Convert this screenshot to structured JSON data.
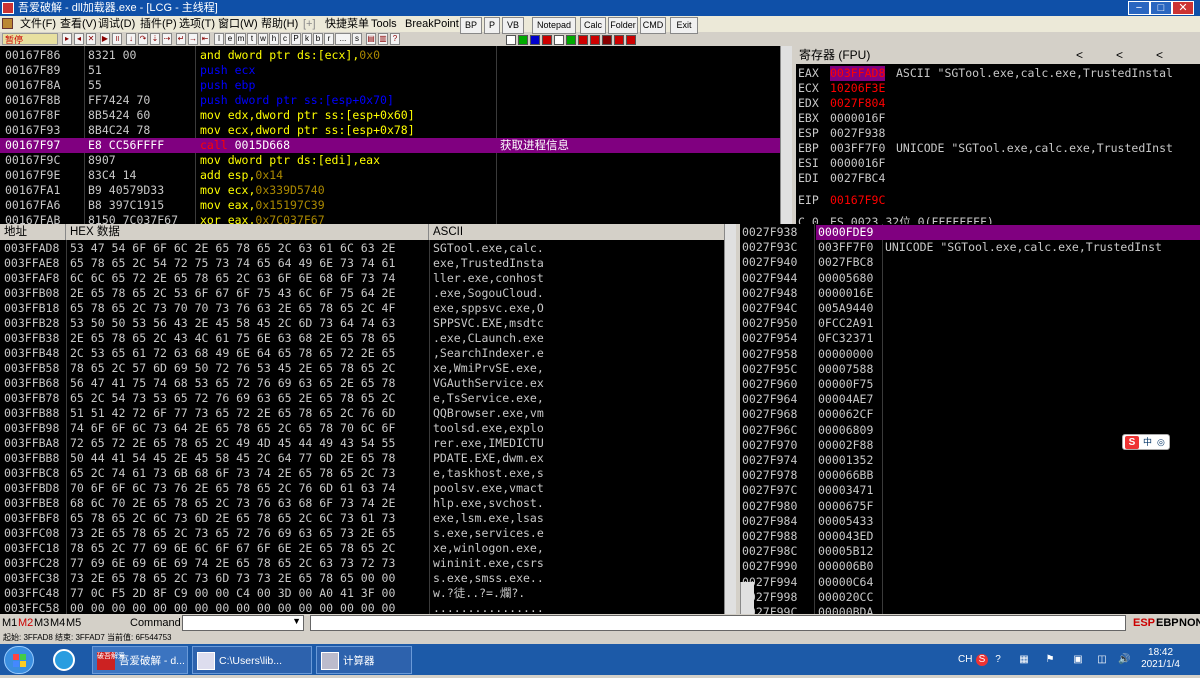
{
  "titlebar": {
    "title": "吾爱破解 - dll加载器.exe - [LCG - 主线程]"
  },
  "menu": [
    "文件(F)",
    "查看(V)",
    "调试(D)",
    "插件(P)",
    "选项(T)",
    "窗口(W)",
    "帮助(H)",
    "[+]",
    "快捷菜单",
    "Tools",
    "BreakPoint"
  ],
  "tabs": [
    "BP",
    "P",
    "VB",
    "Notepad",
    "Calc",
    "Folder",
    "CMD",
    "Exit"
  ],
  "toolbar": {
    "state": "暂停",
    "letters": [
      "l",
      "e",
      "m",
      "t",
      "w",
      "h",
      "c",
      "P",
      "k",
      "b",
      "r",
      "...",
      "s"
    ]
  },
  "disasm": [
    {
      "addr": "00167F86",
      "hex": "8321 00",
      "asm": [
        [
          "and",
          "#ff0"
        ],
        [
          " dword ptr ds:[ecx],",
          "#ff0"
        ],
        [
          "0x0",
          "#a80"
        ]
      ],
      "cmt": ""
    },
    {
      "addr": "00167F89",
      "hex": "51",
      "asm": [
        [
          "push",
          "#00f"
        ],
        [
          " ecx",
          "#00f"
        ]
      ],
      "cmt": ""
    },
    {
      "addr": "00167F8A",
      "hex": "55",
      "asm": [
        [
          "push",
          "#00f"
        ],
        [
          " ebp",
          "#00f"
        ]
      ],
      "cmt": ""
    },
    {
      "addr": "00167F8B",
      "hex": "FF7424 70",
      "asm": [
        [
          "push",
          "#00f"
        ],
        [
          " dword ptr ss:[esp+0x70]",
          "#00f"
        ]
      ],
      "cmt": ""
    },
    {
      "addr": "00167F8F",
      "hex": "8B5424 60",
      "asm": [
        [
          "mov",
          "#ff0"
        ],
        [
          " edx,dword ptr ss:[esp+0x60]",
          "#ff0"
        ]
      ],
      "cmt": ""
    },
    {
      "addr": "00167F93",
      "hex": "8B4C24 78",
      "asm": [
        [
          "mov",
          "#ff0"
        ],
        [
          " ecx,dword ptr ss:[esp+0x78]",
          "#ff0"
        ]
      ],
      "cmt": ""
    },
    {
      "addr": "00167F97",
      "hex": "E8 CC56FFFF",
      "asm": [
        [
          "call",
          "#f00"
        ],
        [
          " 0015D668",
          "#fff"
        ]
      ],
      "cmt": "获取进程信息",
      "sel": true
    },
    {
      "addr": "00167F9C",
      "hex": "8907",
      "asm": [
        [
          "mov",
          "#ff0"
        ],
        [
          " dword ptr ds:[edi],eax",
          "#ff0"
        ]
      ],
      "cmt": ""
    },
    {
      "addr": "00167F9E",
      "hex": "83C4 14",
      "asm": [
        [
          "add",
          "#ff0"
        ],
        [
          " esp,",
          "#ff0"
        ],
        [
          "0x14",
          "#a80"
        ]
      ],
      "cmt": ""
    },
    {
      "addr": "00167FA1",
      "hex": "B9 40579D33",
      "asm": [
        [
          "mov",
          "#ff0"
        ],
        [
          " ecx,",
          "#ff0"
        ],
        [
          "0x339D5740",
          "#a80"
        ]
      ],
      "cmt": ""
    },
    {
      "addr": "00167FA6",
      "hex": "B8 397C1915",
      "asm": [
        [
          "mov",
          "#ff0"
        ],
        [
          " eax,",
          "#ff0"
        ],
        [
          "0x15197C39",
          "#a80"
        ]
      ],
      "cmt": ""
    },
    {
      "addr": "00167FAB",
      "hex": "8150 7C037F67",
      "asm": [
        [
          "xor",
          "#ff0"
        ],
        [
          " eax,",
          "#ff0"
        ],
        [
          "0x7C037F67",
          "#a80"
        ]
      ],
      "cmt": ""
    }
  ],
  "registers": {
    "header": "寄存器 (FPU)",
    "arrows": [
      "<",
      "<",
      "<"
    ],
    "rows": [
      {
        "name": "EAX",
        "val": "003FFAD8",
        "valcolor": "#f00",
        "hl": true,
        "desc": "ASCII \"SGTool.exe,calc.exe,TrustedInstal"
      },
      {
        "name": "ECX",
        "val": "10206F3E",
        "valcolor": "#f00",
        "desc": ""
      },
      {
        "name": "EDX",
        "val": "0027F804",
        "valcolor": "#f00",
        "desc": ""
      },
      {
        "name": "EBX",
        "val": "0000016F",
        "valcolor": "#c8c8c8",
        "desc": ""
      },
      {
        "name": "ESP",
        "val": "0027F938",
        "valcolor": "#c8c8c8",
        "desc": ""
      },
      {
        "name": "EBP",
        "val": "003FF7F0",
        "valcolor": "#c8c8c8",
        "desc": "UNICODE \"SGTool.exe,calc.exe,TrustedInst"
      },
      {
        "name": "ESI",
        "val": "0000016F",
        "valcolor": "#c8c8c8",
        "desc": ""
      },
      {
        "name": "EDI",
        "val": "0027FBC4",
        "valcolor": "#c8c8c8",
        "desc": ""
      },
      {
        "name": "EIP",
        "val": "00167F9C",
        "valcolor": "#f00",
        "desc": ""
      },
      {
        "name": "C 0",
        "val": "ES 0023 32位 0(FFFFFFFF)",
        "valcolor": "#c8c8c8",
        "desc": ""
      }
    ]
  },
  "dump": {
    "headers": [
      "地址",
      "HEX 数据",
      "ASCII"
    ],
    "rows": [
      {
        "addr": "003FFAD8",
        "hex": "53 47 54 6F 6F 6C 2E 65 78 65 2C 63 61 6C 63 2E",
        "asc": "SGTool.exe,calc."
      },
      {
        "addr": "003FFAE8",
        "hex": "65 78 65 2C 54 72 75 73 74 65 64 49 6E 73 74 61",
        "asc": "exe,TrustedInsta"
      },
      {
        "addr": "003FFAF8",
        "hex": "6C 6C 65 72 2E 65 78 65 2C 63 6F 6E 68 6F 73 74",
        "asc": "ller.exe,conhost"
      },
      {
        "addr": "003FFB08",
        "hex": "2E 65 78 65 2C 53 6F 67 6F 75 43 6C 6F 75 64 2E",
        "asc": ".exe,SogouCloud."
      },
      {
        "addr": "003FFB18",
        "hex": "65 78 65 2C 73 70 70 73 76 63 2E 65 78 65 2C 4F",
        "asc": "exe,sppsvc.exe,O"
      },
      {
        "addr": "003FFB28",
        "hex": "53 50 50 53 56 43 2E 45 58 45 2C 6D 73 64 74 63",
        "asc": "SPPSVC.EXE,msdtc"
      },
      {
        "addr": "003FFB38",
        "hex": "2E 65 78 65 2C 43 4C 61 75 6E 63 68 2E 65 78 65",
        "asc": ".exe,CLaunch.exe"
      },
      {
        "addr": "003FFB48",
        "hex": "2C 53 65 61 72 63 68 49 6E 64 65 78 65 72 2E 65",
        "asc": ",SearchIndexer.e"
      },
      {
        "addr": "003FFB58",
        "hex": "78 65 2C 57 6D 69 50 72 76 53 45 2E 65 78 65 2C",
        "asc": "xe,WmiPrvSE.exe,"
      },
      {
        "addr": "003FFB68",
        "hex": "56 47 41 75 74 68 53 65 72 76 69 63 65 2E 65 78",
        "asc": "VGAuthService.ex"
      },
      {
        "addr": "003FFB78",
        "hex": "65 2C 54 73 53 65 72 76 69 63 65 2E 65 78 65 2C",
        "asc": "e,TsService.exe,"
      },
      {
        "addr": "003FFB88",
        "hex": "51 51 42 72 6F 77 73 65 72 2E 65 78 65 2C 76 6D",
        "asc": "QQBrowser.exe,vm"
      },
      {
        "addr": "003FFB98",
        "hex": "74 6F 6F 6C 73 64 2E 65 78 65 2C 65 78 70 6C 6F",
        "asc": "toolsd.exe,explo"
      },
      {
        "addr": "003FFBA8",
        "hex": "72 65 72 2E 65 78 65 2C 49 4D 45 44 49 43 54 55",
        "asc": "rer.exe,IMEDICTU"
      },
      {
        "addr": "003FFBB8",
        "hex": "50 44 41 54 45 2E 45 58 45 2C 64 77 6D 2E 65 78",
        "asc": "PDATE.EXE,dwm.ex"
      },
      {
        "addr": "003FFBC8",
        "hex": "65 2C 74 61 73 6B 68 6F 73 74 2E 65 78 65 2C 73",
        "asc": "e,taskhost.exe,s"
      },
      {
        "addr": "003FFBD8",
        "hex": "70 6F 6F 6C 73 76 2E 65 78 65 2C 76 6D 61 63 74",
        "asc": "poolsv.exe,vmact"
      },
      {
        "addr": "003FFBE8",
        "hex": "68 6C 70 2E 65 78 65 2C 73 76 63 68 6F 73 74 2E",
        "asc": "hlp.exe,svchost."
      },
      {
        "addr": "003FFBF8",
        "hex": "65 78 65 2C 6C 73 6D 2E 65 78 65 2C 6C 73 61 73",
        "asc": "exe,lsm.exe,lsas"
      },
      {
        "addr": "003FFC08",
        "hex": "73 2E 65 78 65 2C 73 65 72 76 69 63 65 73 2E 65",
        "asc": "s.exe,services.e"
      },
      {
        "addr": "003FFC18",
        "hex": "78 65 2C 77 69 6E 6C 6F 67 6F 6E 2E 65 78 65 2C",
        "asc": "xe,winlogon.exe,"
      },
      {
        "addr": "003FFC28",
        "hex": "77 69 6E 69 6E 69 74 2E 65 78 65 2C 63 73 72 73",
        "asc": "wininit.exe,csrs"
      },
      {
        "addr": "003FFC38",
        "hex": "73 2E 65 78 65 2C 73 6D 73 73 2E 65 78 65 00 00",
        "asc": "s.exe,smss.exe.."
      },
      {
        "addr": "003FFC48",
        "hex": "77 0C F5 2D 8F C9 00 00 C4 00 3D 00 A0 41 3F 00",
        "asc": "w.?徒..?=.爛?."
      },
      {
        "addr": "003FFC58",
        "hex": "00 00 00 00 00 00 00 00 00 00 00 00 00 00 00 00",
        "asc": "................"
      }
    ]
  },
  "stack": [
    {
      "addr": "0027F938",
      "val": "0000FDE9",
      "cmt": "",
      "sel": true
    },
    {
      "addr": "0027F93C",
      "val": "003FF7F0",
      "cmt": "UNICODE \"SGTool.exe,calc.exe,TrustedInst"
    },
    {
      "addr": "0027F940",
      "val": "0027FBC8",
      "cmt": ""
    },
    {
      "addr": "0027F944",
      "val": "00005680",
      "cmt": ""
    },
    {
      "addr": "0027F948",
      "val": "0000016E",
      "cmt": ""
    },
    {
      "addr": "0027F94C",
      "val": "005A9440",
      "cmt": ""
    },
    {
      "addr": "0027F950",
      "val": "0FCC2A91",
      "cmt": ""
    },
    {
      "addr": "0027F954",
      "val": "0FC32371",
      "cmt": ""
    },
    {
      "addr": "0027F958",
      "val": "00000000",
      "cmt": ""
    },
    {
      "addr": "0027F95C",
      "val": "00007588",
      "cmt": ""
    },
    {
      "addr": "0027F960",
      "val": "00000F75",
      "cmt": ""
    },
    {
      "addr": "0027F964",
      "val": "00004AE7",
      "cmt": ""
    },
    {
      "addr": "0027F968",
      "val": "000062CF",
      "cmt": ""
    },
    {
      "addr": "0027F96C",
      "val": "00006809",
      "cmt": ""
    },
    {
      "addr": "0027F970",
      "val": "00002F88",
      "cmt": ""
    },
    {
      "addr": "0027F974",
      "val": "00001352",
      "cmt": ""
    },
    {
      "addr": "0027F978",
      "val": "000066BB",
      "cmt": ""
    },
    {
      "addr": "0027F97C",
      "val": "00003471",
      "cmt": ""
    },
    {
      "addr": "0027F980",
      "val": "0000675F",
      "cmt": ""
    },
    {
      "addr": "0027F984",
      "val": "00005433",
      "cmt": ""
    },
    {
      "addr": "0027F988",
      "val": "000043ED",
      "cmt": ""
    },
    {
      "addr": "0027F98C",
      "val": "00005B12",
      "cmt": ""
    },
    {
      "addr": "0027F990",
      "val": "000006B0",
      "cmt": ""
    },
    {
      "addr": "0027F994",
      "val": "00000C64",
      "cmt": ""
    },
    {
      "addr": "0027F998",
      "val": "000020CC",
      "cmt": ""
    },
    {
      "addr": "0027F99C",
      "val": "00000BDA",
      "cmt": ""
    }
  ],
  "ime": {
    "label": "中"
  },
  "cmdbar": {
    "m_tabs": [
      "M1",
      "M2",
      "M3",
      "M4",
      "M5"
    ],
    "command_label": "Command",
    "esp": "ESP",
    "ebp": "EBP",
    "none": "NONE"
  },
  "statusbar": {
    "text": "起始: 3FFAD8 结束: 3FFAD7 当前值: 6F544753"
  },
  "taskbar": {
    "apps": [
      {
        "label": "吾爱破解 - d...",
        "icolabel": "破吾解爱"
      },
      {
        "label": "C:\\Users\\lib...",
        "icolabel": ""
      },
      {
        "label": "计算器",
        "icolabel": ""
      }
    ],
    "tray": [
      "CH",
      "S",
      "?",
      "▦",
      "⚑",
      "▣",
      "◫",
      "🔊"
    ],
    "time": "18:42",
    "date": "2021/1/4"
  },
  "colors": {
    "selection": "#800080",
    "keyword_yellow": "#ffff00",
    "push_blue": "#0000ff",
    "call_red": "#ff0000",
    "titlebar": "#0f50a8"
  }
}
